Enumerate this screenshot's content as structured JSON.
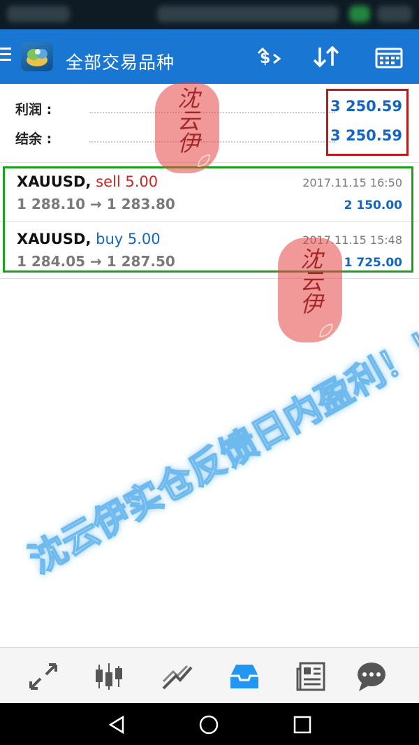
{
  "header": {
    "title": "全部交易品种"
  },
  "summary": {
    "profit_label": "利润 :",
    "profit_value": "3 250.59",
    "balance_label": "结余 :",
    "balance_value": "3 250.59"
  },
  "trades": [
    {
      "symbol": "XAUUSD,",
      "direction": "sell 5.00",
      "direction_color": "#c62828",
      "prices": "1 288.10 → 1 283.80",
      "time": "2017.11.15 16:50",
      "profit": "2 150.00"
    },
    {
      "symbol": "XAUUSD,",
      "direction": "buy 5.00",
      "direction_color": "#1565c0",
      "prices": "1 284.05 → 1 287.50",
      "time": "2017.11.15 15:48",
      "profit": "1 725.00"
    }
  ],
  "stamps": [
    {
      "text": "沈云伊"
    },
    {
      "text": "沈云伊"
    }
  ],
  "watermark": {
    "text": "沈云伊实仓反馈日内盈利！！"
  },
  "bottom_nav": {
    "items": [
      "quotes-icon",
      "chart-icon",
      "trade-icon",
      "history-icon",
      "news-icon",
      "chat-icon"
    ],
    "active_color": "#2196f3",
    "inactive_color": "#555555"
  },
  "colors": {
    "app_bar": "#1976d2",
    "value_blue": "#1565c0",
    "highlight_red_box": "#b71c1c",
    "highlight_green_box": "#1aa31a"
  }
}
